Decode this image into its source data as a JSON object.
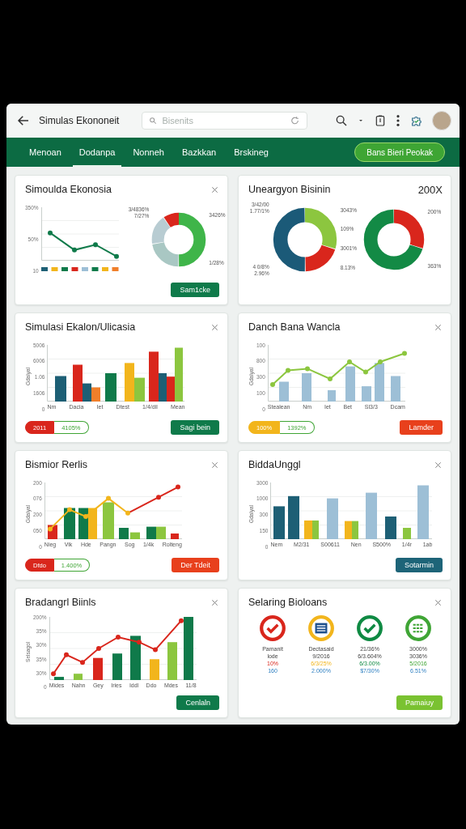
{
  "app_bar": {
    "title": "Simulas Ekononeit",
    "search": {
      "placeholder": "Bisenits"
    }
  },
  "nav": {
    "tabs": [
      {
        "label": "Menoan",
        "selected": false
      },
      {
        "label": "Dodanpa",
        "selected": true
      },
      {
        "label": "Nonneh",
        "selected": false
      },
      {
        "label": "Bazkkan",
        "selected": false
      },
      {
        "label": "Brskineg",
        "selected": false
      }
    ],
    "action": "Bans Bieri Peokak"
  },
  "cards": [
    {
      "title": "Simoulda Ekonosia",
      "close": true,
      "kind": "line-donut",
      "chart": {
        "y_ticks": [
          "350%",
          "50%",
          "10"
        ]
      },
      "donuts": [
        {
          "left_labels": [
            "3/4836%",
            "7/27%"
          ],
          "right_labels": [
            "3426%",
            "1/28%"
          ]
        }
      ],
      "button": {
        "label": "Sam1cke",
        "color": "#0f7a4a"
      }
    },
    {
      "title": "Uneargyon Bisinin",
      "badge": "200X",
      "kind": "donuts",
      "donuts": [
        {
          "left_labels": [
            "3/42/00",
            "1.77/1%"
          ],
          "lower_labels": [
            "4 0/8%",
            "2.96%"
          ],
          "right_labels": [
            "3043%",
            "109%",
            "3001%",
            "8.13%"
          ]
        },
        {
          "right_labels": [
            "200%",
            "363%"
          ]
        }
      ]
    },
    {
      "title": "Simulasi Ekalon/Ulicasia",
      "close": true,
      "kind": "grouped-bars",
      "chart": {
        "y_title": "Gdalyal",
        "y_ticks": [
          "5006",
          "6006",
          "1.06",
          "1606",
          "0"
        ],
        "x_labels": [
          "Nm",
          "Dacia",
          "Iet",
          "Dtest",
          "1/4/dil",
          "Mean"
        ]
      },
      "pills": [
        {
          "label": "2011",
          "color": "#d9261c"
        },
        {
          "label": "4105%",
          "color": "#3fa535"
        }
      ],
      "button": {
        "label": "Sagi bein",
        "color": "#0f7a4a"
      }
    },
    {
      "title": "Danch Bana Wancla",
      "close": true,
      "kind": "bars-line",
      "chart": {
        "y_title": "Gdalyal",
        "y_ticks": [
          "100",
          "800",
          "300",
          "100",
          "0"
        ],
        "x_labels": [
          "Stealean",
          "Nm",
          "Iet",
          "Bet",
          "Sl3/3",
          "Dcam"
        ]
      },
      "pills": [
        {
          "label": "100%",
          "color": "#f2b51c"
        },
        {
          "label": "1392%",
          "color": "#3fa535"
        }
      ],
      "button": {
        "label": "Lamder",
        "color": "#e8401c"
      }
    },
    {
      "title": "Bismior Rerlis",
      "close": true,
      "kind": "combo",
      "chart": {
        "y_title": "Gdalyal",
        "y_ticks": [
          "200",
          "076",
          "200",
          "050",
          "0"
        ],
        "x_labels": [
          "Nieg",
          "Vik",
          "Hde",
          "Pangn",
          "Sog",
          "1/4k",
          "Rolteng"
        ]
      },
      "pills": [
        {
          "label": "Dfdo",
          "color": "#d9261c"
        },
        {
          "label": "1.400%",
          "color": "#3fa535"
        }
      ],
      "button": {
        "label": "Der Tdeit",
        "color": "#e8401c"
      }
    },
    {
      "title": "BiddaUnggl",
      "close": true,
      "kind": "plain-bars",
      "chart": {
        "y_title": "Gdalyal",
        "y_ticks": [
          "3000",
          "1000",
          "300",
          "150",
          "0"
        ],
        "x_labels": [
          "Nem",
          "M2/31",
          "S00611",
          "Nen",
          "S500%",
          "1/4r",
          "1ab"
        ]
      },
      "button": {
        "label": "Sotarmin",
        "color": "#1d6478"
      }
    },
    {
      "title": "Bradangrl Biinls",
      "close": true,
      "kind": "trend-bars",
      "chart": {
        "y_title": "Selsagol",
        "y_ticks": [
          "200%",
          "35%",
          "30%",
          "35%",
          "30%",
          "0"
        ],
        "x_labels": [
          "Mides",
          "Nahn",
          "Gey",
          "Iries",
          "Iddl",
          "Ddo",
          "Mdes",
          "11/8"
        ]
      },
      "button": {
        "label": "Cenlaln",
        "color": "#0f7a4a"
      }
    },
    {
      "title": "Selaring Bioloans",
      "close": true,
      "kind": "status",
      "status": [
        {
          "kind": "check",
          "color": "#d9261c",
          "lines": [
            "Pamanit",
            "lode",
            "10%",
            "160"
          ]
        },
        {
          "kind": "list",
          "color": "#f2b51c",
          "lines": [
            "Dectasaid",
            "9/2016",
            "6/3/25%",
            "2.000%"
          ]
        },
        {
          "kind": "check",
          "color": "#0f8a43",
          "lines": [
            "21/36%",
            "6/3.604%",
            "6/3.00%",
            "$7/30%"
          ]
        },
        {
          "kind": "grid",
          "color": "#3fa535",
          "lines": [
            "3000%",
            "3036%",
            "5/2016",
            "6.51%"
          ]
        }
      ],
      "button": {
        "label": "Pamaiuy",
        "color": "#7ac231"
      }
    }
  ]
}
